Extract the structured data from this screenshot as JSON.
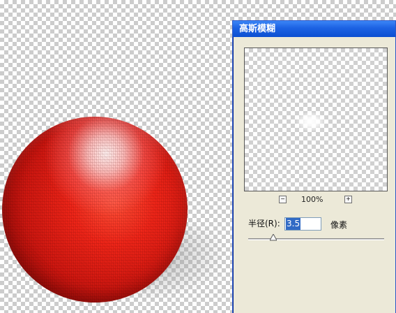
{
  "dialog": {
    "title": "高斯模糊",
    "zoom": {
      "minus_symbol": "−",
      "value": "100%",
      "plus_symbol": "+"
    },
    "radius": {
      "label": "半径(R):",
      "value": "3.5",
      "unit": "像素"
    },
    "slider": {
      "value": 0.12
    }
  },
  "canvas": {
    "ball_color": "#e12b1d",
    "ball_shadow_color": "#9b9b9b"
  },
  "colors": {
    "dialog_title_bar": "#1d63e4",
    "dialog_background": "#ece9d8",
    "selection_highlight": "#316ac5"
  },
  "icons": {
    "preview_glow": "soft-white-glow",
    "slider_thumb": "triangle-thumb"
  }
}
